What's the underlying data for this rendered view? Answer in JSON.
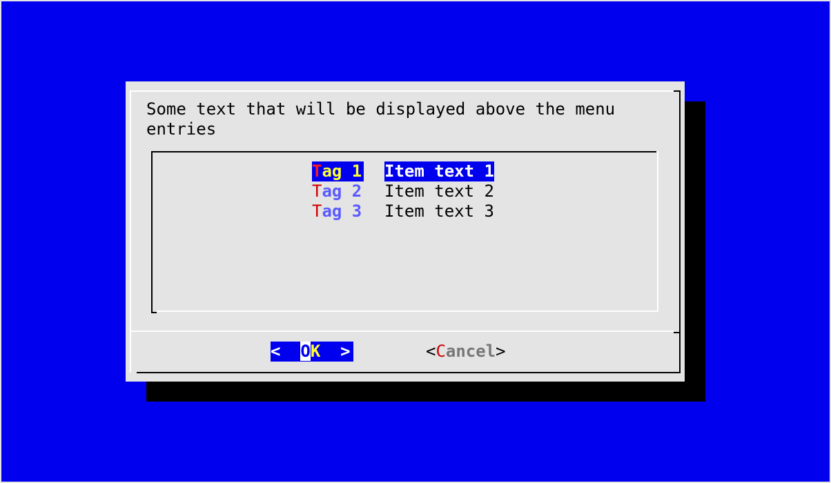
{
  "dialog": {
    "prompt_text": "Some text that will be displayed above the menu\nentries"
  },
  "menu": {
    "items": [
      {
        "tag_hot": "T",
        "tag_rest": "ag 1",
        "text": "Item text 1",
        "selected": true
      },
      {
        "tag_hot": "T",
        "tag_rest": "ag 2",
        "text": "Item text 2",
        "selected": false
      },
      {
        "tag_hot": "T",
        "tag_rest": "ag 3",
        "text": "Item text 3",
        "selected": false
      }
    ]
  },
  "buttons": {
    "ok": {
      "left": "<  ",
      "cursor_char": "O",
      "hot": "K",
      "right": "  >"
    },
    "cancel": {
      "open": "<",
      "hot": "C",
      "rest": "ancel",
      "close": ">"
    }
  },
  "colors": {
    "background": "#0000ee",
    "dialog": "#e4e4e4",
    "highlight": "#0000ee",
    "hotkey": "#cc0000",
    "tag": "#5a5aff",
    "selected_tag": "#ffff33"
  }
}
